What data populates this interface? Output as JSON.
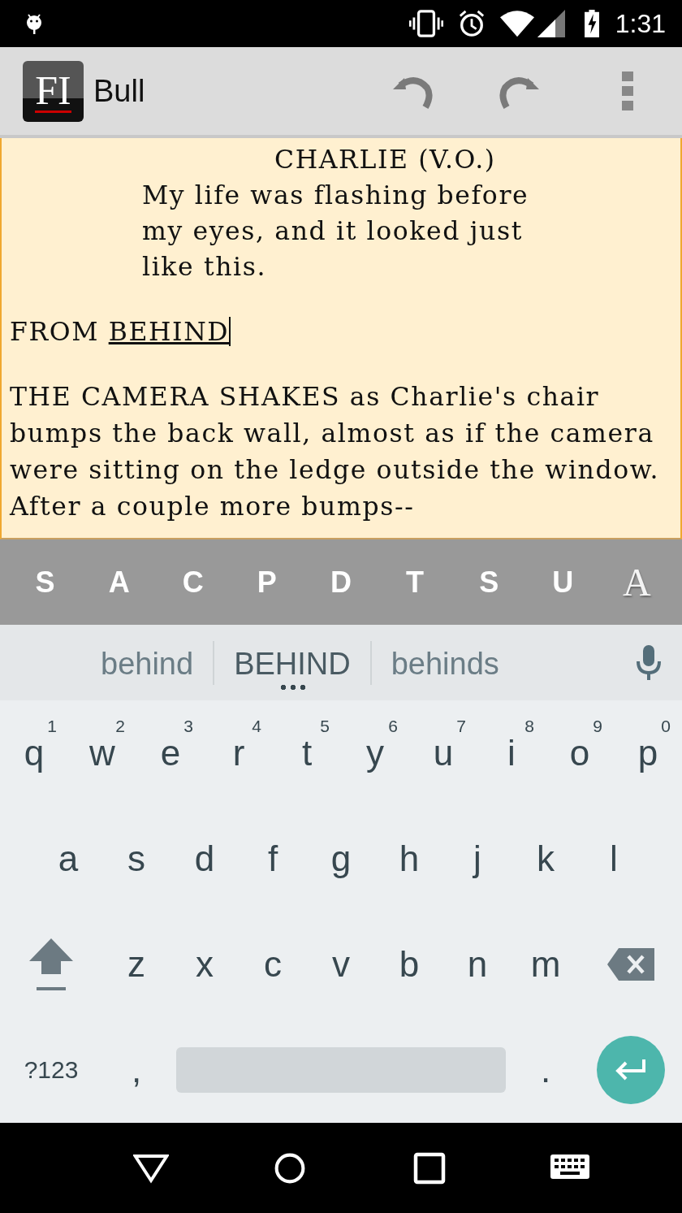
{
  "status_bar": {
    "time": "1:31"
  },
  "app_bar": {
    "logo": "FI",
    "title": "Bull"
  },
  "script": [
    {
      "kind": "character",
      "text": "CHARLIE (V.O.)"
    },
    {
      "kind": "dialogue",
      "text": "My life was flashing before my eyes, and it looked just like this."
    },
    {
      "kind": "shot",
      "text": "FROM ",
      "composing": "BEHIND",
      "cursor": true
    },
    {
      "kind": "action",
      "text": "THE CAMERA SHAKES as Charlie's chair bumps the back wall, almost as if the camera were sitting on the ledge outside the window.  After a couple more bumps--"
    }
  ],
  "format_bar": [
    {
      "kind": "letter",
      "text": "S"
    },
    {
      "kind": "letter",
      "text": "A"
    },
    {
      "kind": "letter",
      "text": "C"
    },
    {
      "kind": "letter",
      "text": "P"
    },
    {
      "kind": "letter",
      "text": "D"
    },
    {
      "kind": "letter",
      "text": "T"
    },
    {
      "kind": "letter",
      "text": "S"
    },
    {
      "kind": "letter",
      "text": "U"
    },
    {
      "kind": "style",
      "text": "A"
    }
  ],
  "suggestions": [
    {
      "text": "behind",
      "selected": false
    },
    {
      "text": "BEHIND",
      "selected": true
    },
    {
      "text": "behinds",
      "selected": false
    }
  ],
  "keyboard": {
    "rows": [
      [
        {
          "kind": "char",
          "text": "q",
          "hint": "1"
        },
        {
          "kind": "char",
          "text": "w",
          "hint": "2"
        },
        {
          "kind": "char",
          "text": "e",
          "hint": "3"
        },
        {
          "kind": "char",
          "text": "r",
          "hint": "4"
        },
        {
          "kind": "char",
          "text": "t",
          "hint": "5"
        },
        {
          "kind": "char",
          "text": "y",
          "hint": "6"
        },
        {
          "kind": "char",
          "text": "u",
          "hint": "7"
        },
        {
          "kind": "char",
          "text": "i",
          "hint": "8"
        },
        {
          "kind": "char",
          "text": "o",
          "hint": "9"
        },
        {
          "kind": "char",
          "text": "p",
          "hint": "0"
        }
      ],
      [
        {
          "kind": "char",
          "text": "a"
        },
        {
          "kind": "char",
          "text": "s"
        },
        {
          "kind": "char",
          "text": "d"
        },
        {
          "kind": "char",
          "text": "f"
        },
        {
          "kind": "char",
          "text": "g"
        },
        {
          "kind": "char",
          "text": "h"
        },
        {
          "kind": "char",
          "text": "j"
        },
        {
          "kind": "char",
          "text": "k"
        },
        {
          "kind": "char",
          "text": "l"
        }
      ],
      [
        {
          "kind": "shift"
        },
        {
          "kind": "char",
          "text": "z"
        },
        {
          "kind": "char",
          "text": "x"
        },
        {
          "kind": "char",
          "text": "c"
        },
        {
          "kind": "char",
          "text": "v"
        },
        {
          "kind": "char",
          "text": "b"
        },
        {
          "kind": "char",
          "text": "n"
        },
        {
          "kind": "char",
          "text": "m"
        },
        {
          "kind": "backspace"
        }
      ]
    ],
    "bottom_row": {
      "symbols_key": "?123",
      "comma_key": ",",
      "period_key": "."
    }
  }
}
